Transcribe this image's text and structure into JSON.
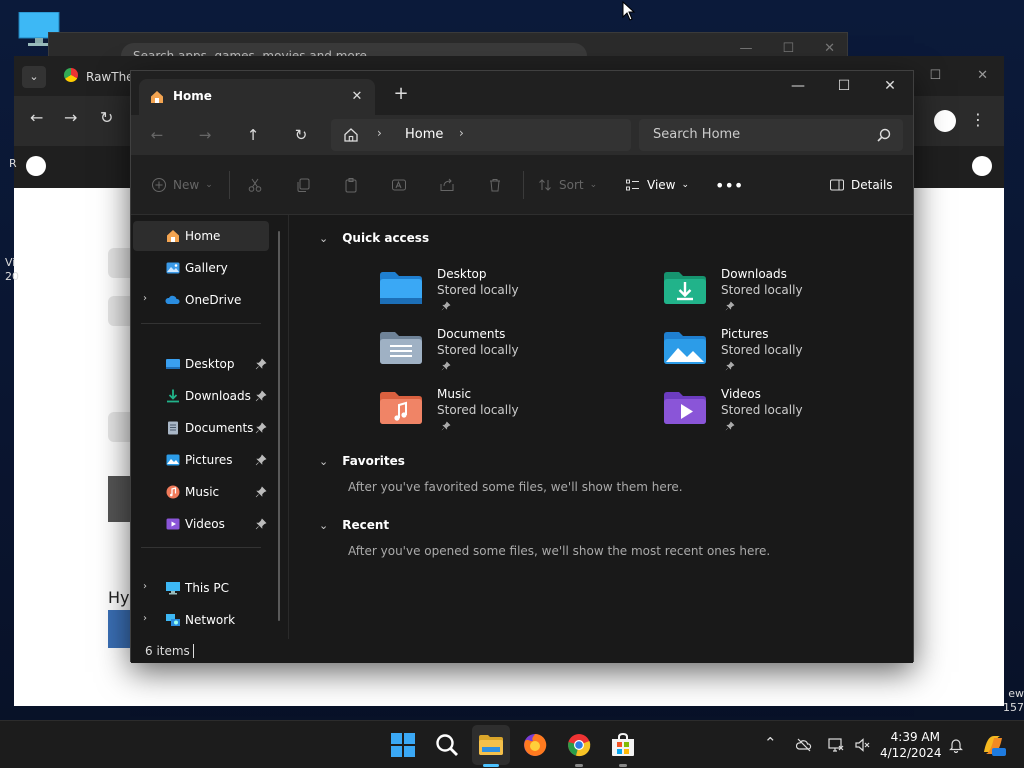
{
  "background": {
    "back_window_search_placeholder": "Search apps, games, movies and more",
    "browser_tab_title": "RawThe",
    "left_text_1": "Vi",
    "left_text_2": "20",
    "left_text_3": "R",
    "hy_text": "Hy",
    "right_text_1": "ew",
    "right_text_2": "157"
  },
  "explorer": {
    "tab_label": "Home",
    "breadcrumb": "Home",
    "search_placeholder": "Search Home",
    "commands": {
      "new": "New",
      "sort": "Sort",
      "view": "View",
      "details": "Details"
    },
    "nav": [
      {
        "label": "Home",
        "icon": "home-icon"
      },
      {
        "label": "Gallery",
        "icon": "gallery-icon"
      },
      {
        "label": "OneDrive",
        "icon": "onedrive-icon"
      },
      {
        "label": "Desktop",
        "icon": "desktop-folder-icon"
      },
      {
        "label": "Downloads",
        "icon": "downloads-folder-icon"
      },
      {
        "label": "Documents",
        "icon": "documents-folder-icon"
      },
      {
        "label": "Pictures",
        "icon": "pictures-folder-icon"
      },
      {
        "label": "Music",
        "icon": "music-folder-icon"
      },
      {
        "label": "Videos",
        "icon": "videos-folder-icon"
      },
      {
        "label": "This PC",
        "icon": "this-pc-icon"
      },
      {
        "label": "Network",
        "icon": "network-icon"
      }
    ],
    "sections": {
      "quick_access": "Quick access",
      "favorites": "Favorites",
      "favorites_empty": "After you've favorited some files, we'll show them here.",
      "recent": "Recent",
      "recent_empty": "After you've opened some files, we'll show the most recent ones here."
    },
    "quick_access": [
      {
        "name": "Desktop",
        "sub": "Stored locally",
        "color": "#3aa0f0"
      },
      {
        "name": "Downloads",
        "sub": "Stored locally",
        "color": "#1fb38a"
      },
      {
        "name": "Documents",
        "sub": "Stored locally",
        "color": "#8fa3b8"
      },
      {
        "name": "Pictures",
        "sub": "Stored locally",
        "color": "#2c9ce8"
      },
      {
        "name": "Music",
        "sub": "Stored locally",
        "color": "#f07a5a"
      },
      {
        "name": "Videos",
        "sub": "Stored locally",
        "color": "#8a55d8"
      }
    ],
    "status": "6 items"
  },
  "taskbar": {
    "time": "4:39 AM",
    "date": "4/12/2024"
  },
  "colors": {
    "accent": "#4cc2ff",
    "folder_yellow": "#f5c04a"
  }
}
